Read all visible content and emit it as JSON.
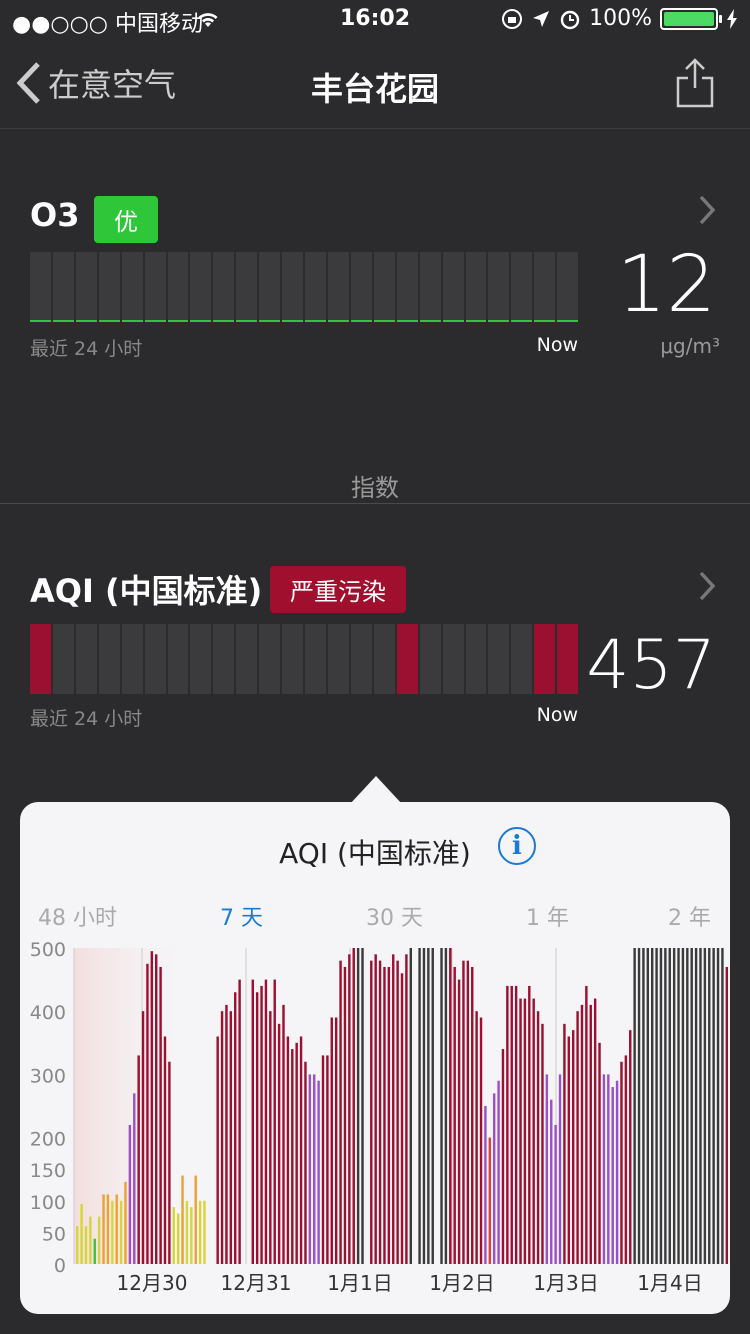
{
  "status": {
    "carrier": "●●○○○ 中国移动",
    "wifi_icon": "wifi-icon",
    "time": "16:02",
    "battery": "100%"
  },
  "nav": {
    "back_label": "在意空气",
    "title": "丰台花园"
  },
  "o3": {
    "name": "O3",
    "level": "优",
    "level_color": "#2fc63a",
    "spark_left": "最近 24 小时",
    "spark_right": "Now",
    "value": "12",
    "unit": "μg/m³"
  },
  "section": {
    "header": "指数"
  },
  "aqi": {
    "name": "AQI (中国标准)",
    "level": "严重污染",
    "level_color": "#a0102e",
    "spark_left": "最近 24 小时",
    "spark_right": "Now",
    "value": "457",
    "red_cells": [
      0,
      16,
      22,
      23
    ]
  },
  "popover": {
    "title": "AQI (中国标准)",
    "ranges": [
      {
        "label": "48 小时",
        "active": false
      },
      {
        "label": "7 天",
        "active": true
      },
      {
        "label": "30 天",
        "active": false
      },
      {
        "label": "1 年",
        "active": false
      },
      {
        "label": "2 年",
        "active": false
      }
    ]
  },
  "chart_data": {
    "type": "bar",
    "ylim": [
      0,
      500
    ],
    "y_ticks": [
      "0",
      "50",
      "100",
      "150",
      "200",
      "300",
      "400",
      "500"
    ],
    "x_labels": [
      "12月30",
      "12月31",
      "1月1日",
      "1月2日",
      "1月3日",
      "1月4日"
    ],
    "values": [
      60,
      95,
      60,
      75,
      40,
      75,
      110,
      110,
      100,
      110,
      100,
      130,
      220,
      270,
      330,
      400,
      475,
      495,
      490,
      470,
      360,
      320,
      90,
      80,
      140,
      100,
      90,
      140,
      100,
      100,
      0,
      0,
      360,
      400,
      410,
      400,
      430,
      450,
      0,
      0,
      450,
      430,
      440,
      450,
      400,
      450,
      380,
      410,
      360,
      340,
      350,
      360,
      320,
      300,
      300,
      290,
      330,
      330,
      390,
      390,
      480,
      470,
      490,
      500,
      520,
      530,
      0,
      480,
      490,
      480,
      470,
      470,
      490,
      480,
      460,
      490,
      520,
      0,
      520,
      520,
      520,
      520,
      0,
      520,
      510,
      500,
      470,
      450,
      480,
      480,
      470,
      400,
      390,
      250,
      200,
      270,
      290,
      340,
      440,
      440,
      440,
      420,
      420,
      440,
      420,
      400,
      380,
      300,
      260,
      220,
      300,
      380,
      360,
      370,
      400,
      410,
      440,
      410,
      420,
      350,
      300,
      300,
      280,
      290,
      320,
      330,
      370,
      520,
      530,
      530,
      530,
      520,
      530,
      520,
      530,
      530,
      520,
      530,
      520,
      530,
      520,
      530,
      530,
      520,
      530,
      520,
      530,
      520,
      470
    ]
  }
}
